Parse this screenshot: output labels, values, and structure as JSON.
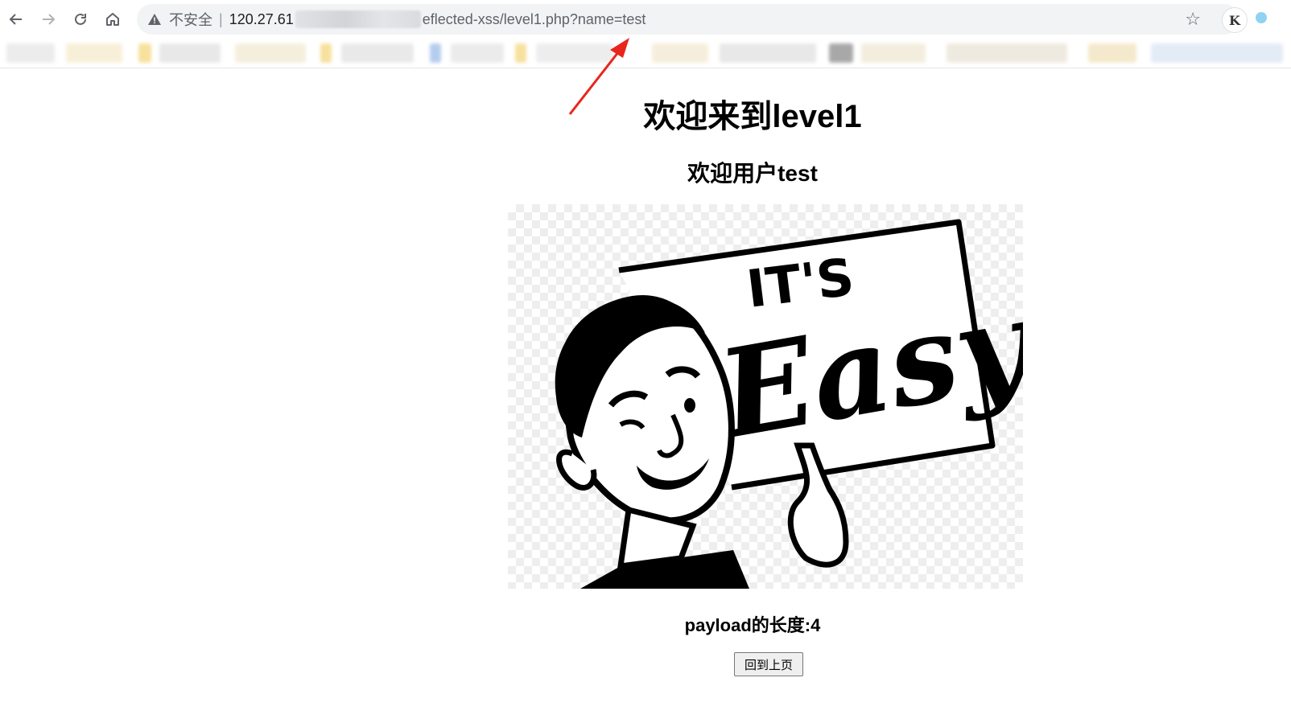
{
  "browser": {
    "back_icon": "arrow-left-icon",
    "forward_icon": "arrow-right-icon",
    "reload_icon": "reload-icon",
    "home_icon": "home-icon",
    "security_label": "不安全",
    "url_host_visible": "120.27.61",
    "url_path_visible": "eflected-xss/level1.php?name=test",
    "bookmark_icon": "star-icon",
    "extension_label": "K"
  },
  "page": {
    "title": "欢迎来到level1",
    "welcome": "欢迎用户test",
    "image_text_line1": "IT'S",
    "image_text_line2": "Easy",
    "payload_length": "payload的长度:4",
    "back_button": "回到上页"
  },
  "colors": {
    "annotation_arrow": "#e8271c",
    "omnibox_bg": "#f1f3f4"
  }
}
